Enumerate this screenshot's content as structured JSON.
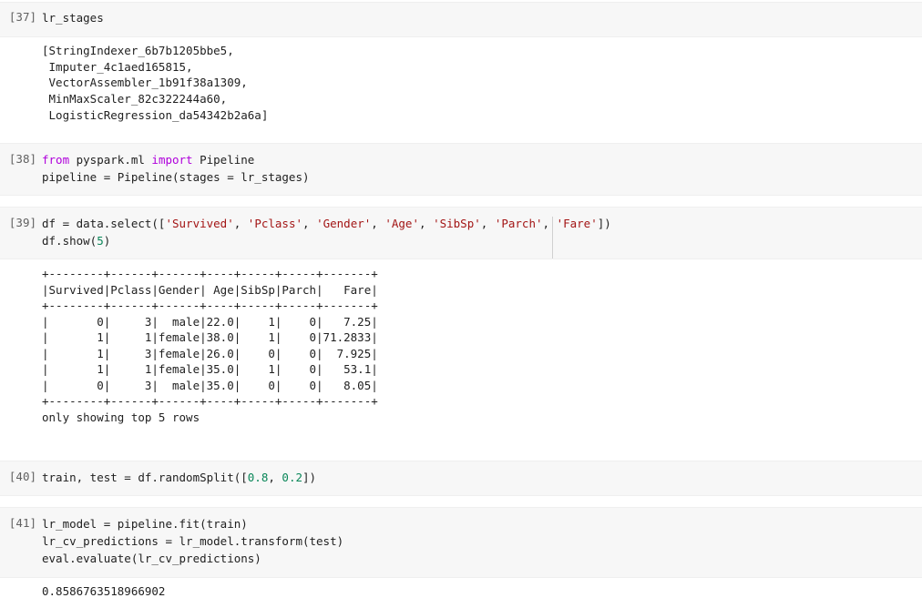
{
  "cells": [
    {
      "prompt": "[37]",
      "code": [
        "lr_stages"
      ],
      "output": [
        "[StringIndexer_6b7b1205bbe5,",
        " Imputer_4c1aed165815,",
        " VectorAssembler_1b91f38a1309,",
        " MinMaxScaler_82c322244a60,",
        " LogisticRegression_da54342b2a6a]"
      ]
    },
    {
      "prompt": "[38]",
      "code": [
        "from pyspark.ml import Pipeline",
        "pipeline = Pipeline(stages = lr_stages)"
      ],
      "output": []
    },
    {
      "prompt": "[39]",
      "code": [
        "df = data.select(['Survived', 'Pclass', 'Gender', 'Age', 'SibSp', 'Parch', 'Fare'])",
        "df.show(5)"
      ],
      "output": [
        "+--------+------+------+----+-----+-----+-------+",
        "|Survived|Pclass|Gender| Age|SibSp|Parch|   Fare|",
        "+--------+------+------+----+-----+-----+-------+",
        "|       0|     3|  male|22.0|    1|    0|   7.25|",
        "|       1|     1|female|38.0|    1|    0|71.2833|",
        "|       1|     3|female|26.0|    0|    0|  7.925|",
        "|       1|     1|female|35.0|    1|    0|   53.1|",
        "|       0|     3|  male|35.0|    0|    0|   8.05|",
        "+--------+------+------+----+-----+-----+-------+",
        "only showing top 5 rows"
      ]
    },
    {
      "prompt": "[40]",
      "code": [
        "train, test = df.randomSplit([0.8, 0.2])"
      ],
      "output": []
    },
    {
      "prompt": "[41]",
      "code": [
        "lr_model = pipeline.fit(train)",
        "lr_cv_predictions = lr_model.transform(test)",
        "eval.evaluate(lr_cv_predictions)"
      ],
      "output": [
        "0.8586763518966902"
      ]
    }
  ]
}
